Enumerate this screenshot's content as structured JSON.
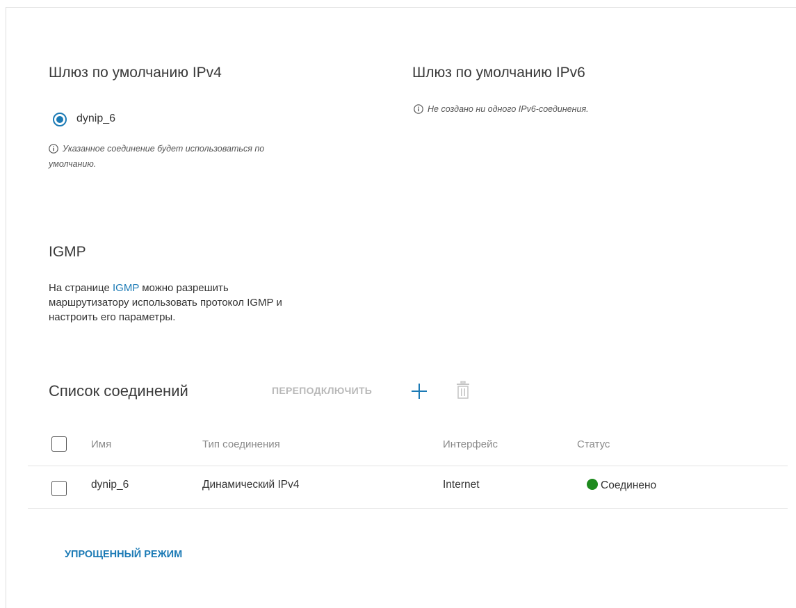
{
  "ipv4_gateway": {
    "title": "Шлюз по умолчанию IPv4",
    "selected_connection": "dynip_6",
    "note_line1": "Указанное соединение будет использоваться по",
    "note_line2": "умолчанию."
  },
  "ipv6_gateway": {
    "title": "Шлюз по умолчанию IPv6",
    "note": "Не создано ни одного IPv6-соединения."
  },
  "igmp": {
    "title": "IGMP",
    "text_prefix": "На странице ",
    "link": "IGMP",
    "text_suffix": " можно разрешить",
    "line2": "маршрутизатору использовать протокол IGMP и",
    "line3": "настроить его параметры."
  },
  "connections": {
    "title": "Список соединений",
    "reconnect_label": "ПЕРЕПОДКЛЮЧИТЬ",
    "columns": [
      "Имя",
      "Тип соединения",
      "Интерфейс",
      "Статус"
    ],
    "rows": [
      {
        "name": "dynip_6",
        "type": "Динамический IPv4",
        "interface": "Internet",
        "status": "Соединено",
        "status_color": "#1e8a1e"
      }
    ]
  },
  "simple_mode_label": "УПРОЩЕННЫЙ РЕЖИМ",
  "colors": {
    "accent": "#1b7ab5",
    "connected": "#1e8a1e",
    "disabled": "#b8b8b8"
  },
  "icons": {
    "info": "info-icon",
    "add": "plus-icon",
    "delete": "trash-icon"
  }
}
